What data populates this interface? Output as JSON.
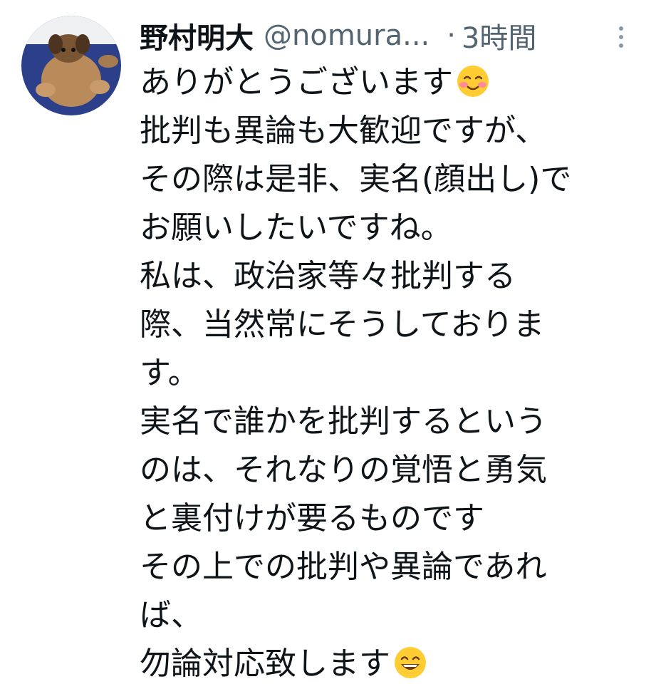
{
  "tweet": {
    "author": {
      "display_name": "野村明大",
      "handle": "@nomura...",
      "avatar_icon": "dog-photo-avatar"
    },
    "separator": "·",
    "time": "3時間",
    "more_icon": "more-options-icon",
    "lines": [
      "ありがとうございます",
      "批判も異論も大歓迎ですが、",
      "その際は是非、実名(顔出し)で",
      "お願いしたいですね。",
      "私は、政治家等々批判する",
      "際、当然常にそうしておりま",
      "す。",
      "実名で誰かを批判するという",
      "のは、それなりの覚悟と勇気",
      "と裏付けが要るものです",
      "その上での批判や異論であれ",
      "ば、",
      "勿論対応致します"
    ],
    "emojis": {
      "line_1": "smiling-face-with-blush-emoji",
      "line_13": "grinning-face-emoji"
    }
  }
}
